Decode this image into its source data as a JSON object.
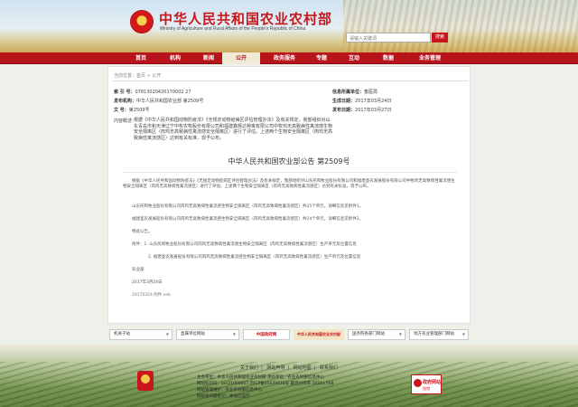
{
  "header": {
    "title": "中华人民共和国农业农村部",
    "subtitle": "Ministry of Agriculture and Rural Affairs of the People's Republic of China",
    "search_placeholder": "请输入关键词",
    "search_button": "搜索"
  },
  "nav": {
    "items": [
      {
        "label": "首页"
      },
      {
        "label": "机构"
      },
      {
        "label": "新闻"
      },
      {
        "label": "公开"
      },
      {
        "label": "政务服务"
      },
      {
        "label": "专题"
      },
      {
        "label": "互动"
      },
      {
        "label": "数据"
      },
      {
        "label": "业务管理"
      }
    ],
    "active_index": 3
  },
  "breadcrumb": "当前位置：首页 > 公开",
  "meta": {
    "index_label": "索 引 号：",
    "index_value": "07813020420170002 27",
    "issuer_label": "发布机构：",
    "issuer_value": "中华人民共和国农业部 第2509号",
    "docno_label": "文 号：",
    "docno_value": "第2509号",
    "info_label": "信息所属单位：",
    "info_value": "畜医局",
    "written_label": "生成日期：",
    "written_value": "2017年03月24日",
    "pub_label": "发布日期：",
    "pub_value": "2017年03月27日",
    "content_label": "内容概述："
  },
  "summary": "根据《中华人民共和国动物防疫法》《无规定动物疫病区评估管理办法》及有关规定，我部组织对山东青岛市和天津辽宁中牧农牧股份有限公司和福建鑫辉达种禽有限公司中牧鸡无高致病性禽流感生物安全隔离区（肉鸡无高致病性禽流感安全隔离区）进行了评估。上述两个生物安全隔离区（肉鸡无高致病性禽流感区）达到有关标准，现予公布。",
  "article": {
    "title": "中华人民共和国农业部公告 第2509号",
    "paragraphs": [
      "根据《中华人民共和国动物防疫法》《无规定动物疫病区评估管理办法》及有关规定，我部组织对山东民和牧业股份有限公司和福建圣农发展股份有限公司中牧鸡无高致病性禽流感生物安全隔离区（肉鸡无高致病性禽流感区）进行了评估。上述两个生物安全隔离区（肉鸡无高致病性禽流感区）达到有关标准，现予公布。",
      "山东民和牧业股份有限公司肉鸡无高致病性禽流感生物安全隔离区（肉鸡无高致病性禽流感区）共25个单元，详细信息见附件1。",
      "福建圣农发展股份有限公司肉鸡无高致病性禽流感生物安全隔离区（肉鸡无高致病性禽流感区）共24个单元，详细信息见附件2。",
      "特此公告。",
      "附件：1. 山东民和牧业股份有限公司肉鸡无高致病性禽流感生物安全隔离区（肉鸡无高致病性禽流感区）生产单元及位置信息",
      "2. 福建圣农发展股份有限公司肉鸡无高致病性禽流感生物安全隔离区（肉鸡无高致病性禽流感区）生产单元及位置信息",
      "农业部",
      "2017年3月24日",
      "20170324 附件.ceb"
    ]
  },
  "links": {
    "items": [
      {
        "label": "机关子站"
      },
      {
        "label": "直属单位网站"
      },
      {
        "label": "中国政府网"
      },
      {
        "label": "中华人民共和国农业农村部"
      },
      {
        "label": "国务院各部门网站"
      },
      {
        "label": "地方农业管理部门网站"
      }
    ]
  },
  "footer": {
    "links": [
      "关于我们",
      "网站声明",
      "网站地图",
      "联系我们"
    ],
    "line1": "主办单位：中华人民共和国农业农村部 承办单位：农业农村部信息中心",
    "line2": "网站标识码：bm21000007 京ICP备05039418号 最佳分辨率 1024×768",
    "line3": "网站管理维护：农业农村部信息中心",
    "line4": "网站访问量统计：本站已运行",
    "badge_line1": "政府网站",
    "badge_line2": "找错"
  },
  "colors": {
    "brand_red": "#b8141b",
    "nav_active_bg": "#f0e9d6"
  }
}
